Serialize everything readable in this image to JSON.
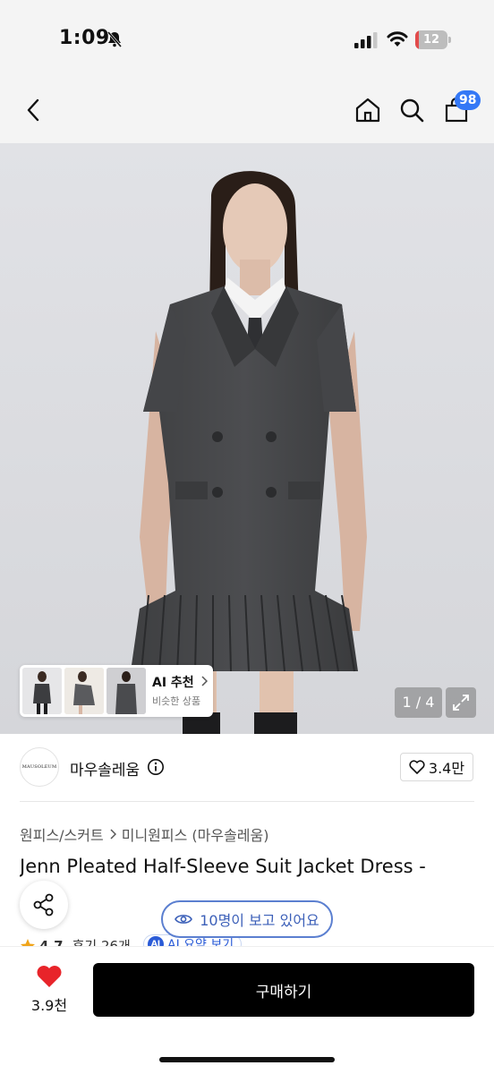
{
  "status_bar": {
    "time": "1:09",
    "battery_level": "12",
    "battery_fraction": 0.12,
    "icons": [
      "bell-slash-icon",
      "cellular-signal-icon",
      "wifi-icon",
      "battery-icon"
    ]
  },
  "nav": {
    "icons": [
      "chevron-left-icon",
      "home-icon",
      "search-icon",
      "shopping-bag-icon"
    ],
    "cart_badge": "98"
  },
  "hero": {
    "page_indicator": "1 / 4",
    "ai_recommend": {
      "title": "AI 추천",
      "subtitle": "비슷한 상품"
    }
  },
  "brand": {
    "logo_text": "MAUSOLEUM",
    "name": "마우솔레움",
    "like_count": "3.4만"
  },
  "breadcrumb": {
    "items": [
      "원피스/스커트",
      "미니원피스 (마우솔레움)"
    ]
  },
  "product": {
    "title": "Jenn Pleated Half-Sleeve Suit Jacket Dress -",
    "rating": "4.7",
    "reviews": "후기 26개",
    "ai_summary_chip": "AI",
    "ai_summary": "AI 요약 보기"
  },
  "viewers": {
    "text": "10명이 보고 있어요"
  },
  "bottom": {
    "fav_count": "3.9천",
    "buy_label": "구매하기"
  },
  "colors": {
    "accent_blue": "#3478f6",
    "heart_red": "#e8242a",
    "buy_button": "#000000"
  }
}
